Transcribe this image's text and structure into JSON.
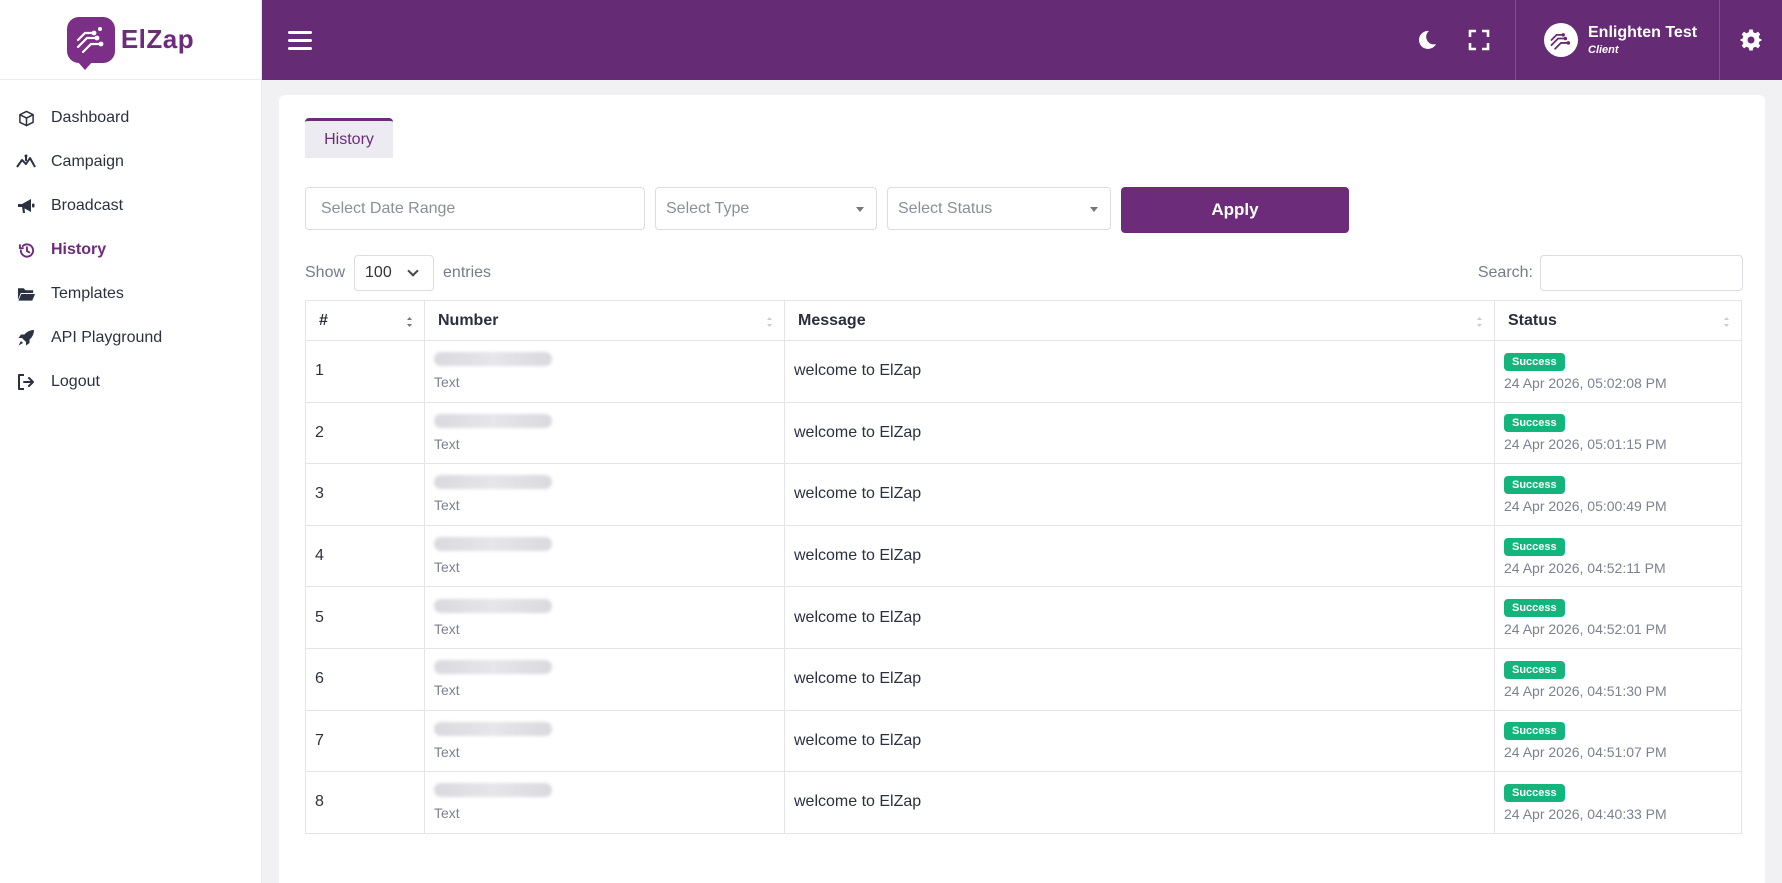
{
  "brand": {
    "name": "ElZap"
  },
  "sidebar": {
    "items": [
      {
        "label": "Dashboard",
        "icon": "cube-icon"
      },
      {
        "label": "Campaign",
        "icon": "campaign-icon"
      },
      {
        "label": "Broadcast",
        "icon": "megaphone-icon"
      },
      {
        "label": "History",
        "icon": "history-icon",
        "active": true
      },
      {
        "label": "Templates",
        "icon": "folder-icon"
      },
      {
        "label": "API Playground",
        "icon": "rocket-icon"
      },
      {
        "label": "Logout",
        "icon": "logout-icon"
      }
    ]
  },
  "topbar": {
    "user_name": "Enlighten Test",
    "user_role": "Client"
  },
  "tabs": {
    "history": "History"
  },
  "filters": {
    "date_placeholder": "Select Date Range",
    "type_placeholder": "Select Type",
    "status_placeholder": "Select Status",
    "apply_label": "Apply"
  },
  "table_controls": {
    "show_label": "Show",
    "entries_value": "100",
    "entries_label": "entries",
    "search_label": "Search:"
  },
  "table": {
    "headers": [
      "#",
      "Number",
      "Message",
      "Status"
    ],
    "rows": [
      {
        "index": "1",
        "number_type": "Text",
        "message": "welcome to ElZap",
        "status": "Success",
        "time": "24 Apr 2026, 05:02:08 PM"
      },
      {
        "index": "2",
        "number_type": "Text",
        "message": "welcome to ElZap",
        "status": "Success",
        "time": "24 Apr 2026, 05:01:15 PM"
      },
      {
        "index": "3",
        "number_type": "Text",
        "message": "welcome to ElZap",
        "status": "Success",
        "time": "24 Apr 2026, 05:00:49 PM"
      },
      {
        "index": "4",
        "number_type": "Text",
        "message": "welcome to ElZap",
        "status": "Success",
        "time": "24 Apr 2026, 04:52:11 PM"
      },
      {
        "index": "5",
        "number_type": "Text",
        "message": "welcome to ElZap",
        "status": "Success",
        "time": "24 Apr 2026, 04:52:01 PM"
      },
      {
        "index": "6",
        "number_type": "Text",
        "message": "welcome to ElZap",
        "status": "Success",
        "time": "24 Apr 2026, 04:51:30 PM"
      },
      {
        "index": "7",
        "number_type": "Text",
        "message": "welcome to ElZap",
        "status": "Success",
        "time": "24 Apr 2026, 04:51:07 PM"
      },
      {
        "index": "8",
        "number_type": "Text",
        "message": "welcome to ElZap",
        "status": "Success",
        "time": "24 Apr 2026, 04:40:33 PM"
      }
    ]
  },
  "colors": {
    "brand": "#652b75",
    "accent": "#6d2c7a",
    "success": "#14b57c"
  }
}
